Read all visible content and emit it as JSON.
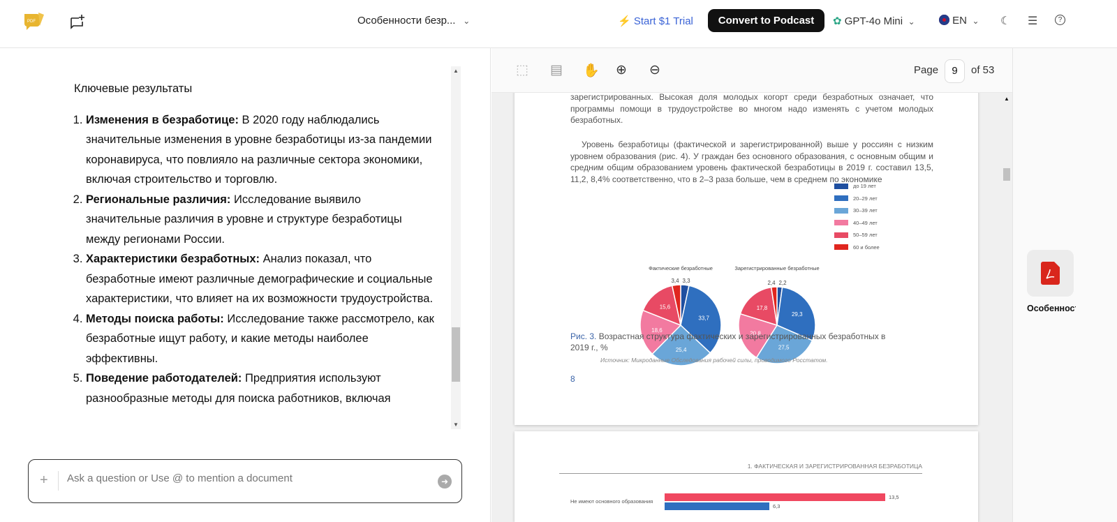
{
  "header": {
    "doc_title": "Особенности безр...",
    "trial": "Start $1 Trial",
    "podcast": "Convert to Podcast",
    "model": "GPT-4o Mini",
    "lang": "EN"
  },
  "chat": {
    "heading": "Ключевые результаты",
    "items": [
      {
        "b": "Изменения в безработице:",
        "t": " В 2020 году наблюдались значительные изменения в уровне безработицы из-за пандемии коронавируса, что повлияло на различные сектора экономики, включая строительство и торговлю."
      },
      {
        "b": "Региональные различия:",
        "t": " Исследование выявило значительные различия в уровне и структуре безработицы между регионами России."
      },
      {
        "b": "Характеристики безработных:",
        "t": " Анализ показал, что безработные имеют различные демографические и социальные характеристики, что влияет на их возможности трудоустройства."
      },
      {
        "b": "Методы поиска работы:",
        "t": " Исследование также рассмотрело, как безработные ищут работу, и какие методы наиболее эффективны."
      },
      {
        "b": "Поведение работодателей:",
        "t": " Предприятия используют разнообразные методы для поиска работников, включая"
      }
    ],
    "input_placeholder": "Ask a question or Use @ to mention a document"
  },
  "viewer": {
    "page_label": "Page",
    "page": "9",
    "of": "of 53",
    "para1": "зарегистрированных. Высокая доля молодых когорт среди безработных означает, что программы помощи в трудоустройстве во многом надо изменять с учетом молодых безработных.",
    "para2": "Уровень безработицы (фактической и зарегистрированной) выше у россиян с низким уровнем образования (рис. 4). У граждан без основного образования, с основным общим и средним общим образованием уровень фактической безработицы в 2019 г. составил 13,5, 11,2, 8,4% соответственно, что в 2–3 раза больше, чем в среднем по экономике",
    "caption_num": "Рис. 3.",
    "caption": "Возрастная структура фактических и зарегистрированных безработных в 2019 г., %",
    "source": "Источник: Микроданные Обследования рабочей силы, проводимого Росстатом.",
    "page_number": "8",
    "next_header": "1. ФАКТИЧЕСКАЯ И ЗАРЕГИСТРИРОВАННАЯ БЕЗРАБОТИЦА",
    "next_row_label": "Не имеют основного образования",
    "next_values": [
      "13,5",
      "6,3"
    ]
  },
  "chart_data": [
    {
      "type": "pie",
      "title": "Фактические безработные",
      "categories": [
        "до 19 лет",
        "20–29 лет",
        "30–39 лет",
        "40–49 лет",
        "50–59 лет",
        "60 и более"
      ],
      "values": [
        3.3,
        33.7,
        25.4,
        18.6,
        15.6,
        3.4
      ],
      "labels": [
        "3,3",
        "33,7",
        "25,4",
        "18,6",
        "15,6",
        "3,4"
      ],
      "colors": [
        "#1f4fa0",
        "#2f6fbf",
        "#6aa6d8",
        "#f27aa0",
        "#e84a64",
        "#e0261f"
      ],
      "legend": "right"
    },
    {
      "type": "pie",
      "title": "Зарегистрированные безработные",
      "categories": [
        "до 19 лет",
        "20–29 лет",
        "30–39 лет",
        "40–49 лет",
        "50–59 лет",
        "60 и более"
      ],
      "values": [
        2.2,
        29.3,
        27.5,
        20.8,
        17.8,
        2.4
      ],
      "labels": [
        "2,2",
        "29,3",
        "27,5",
        "20,8",
        "17,8",
        "2,4"
      ],
      "colors": [
        "#1f4fa0",
        "#2f6fbf",
        "#6aa6d8",
        "#f27aa0",
        "#e84a64",
        "#e0261f"
      ],
      "legend": "right"
    }
  ],
  "sidebar": {
    "file_name": "Особенности безработицы"
  }
}
